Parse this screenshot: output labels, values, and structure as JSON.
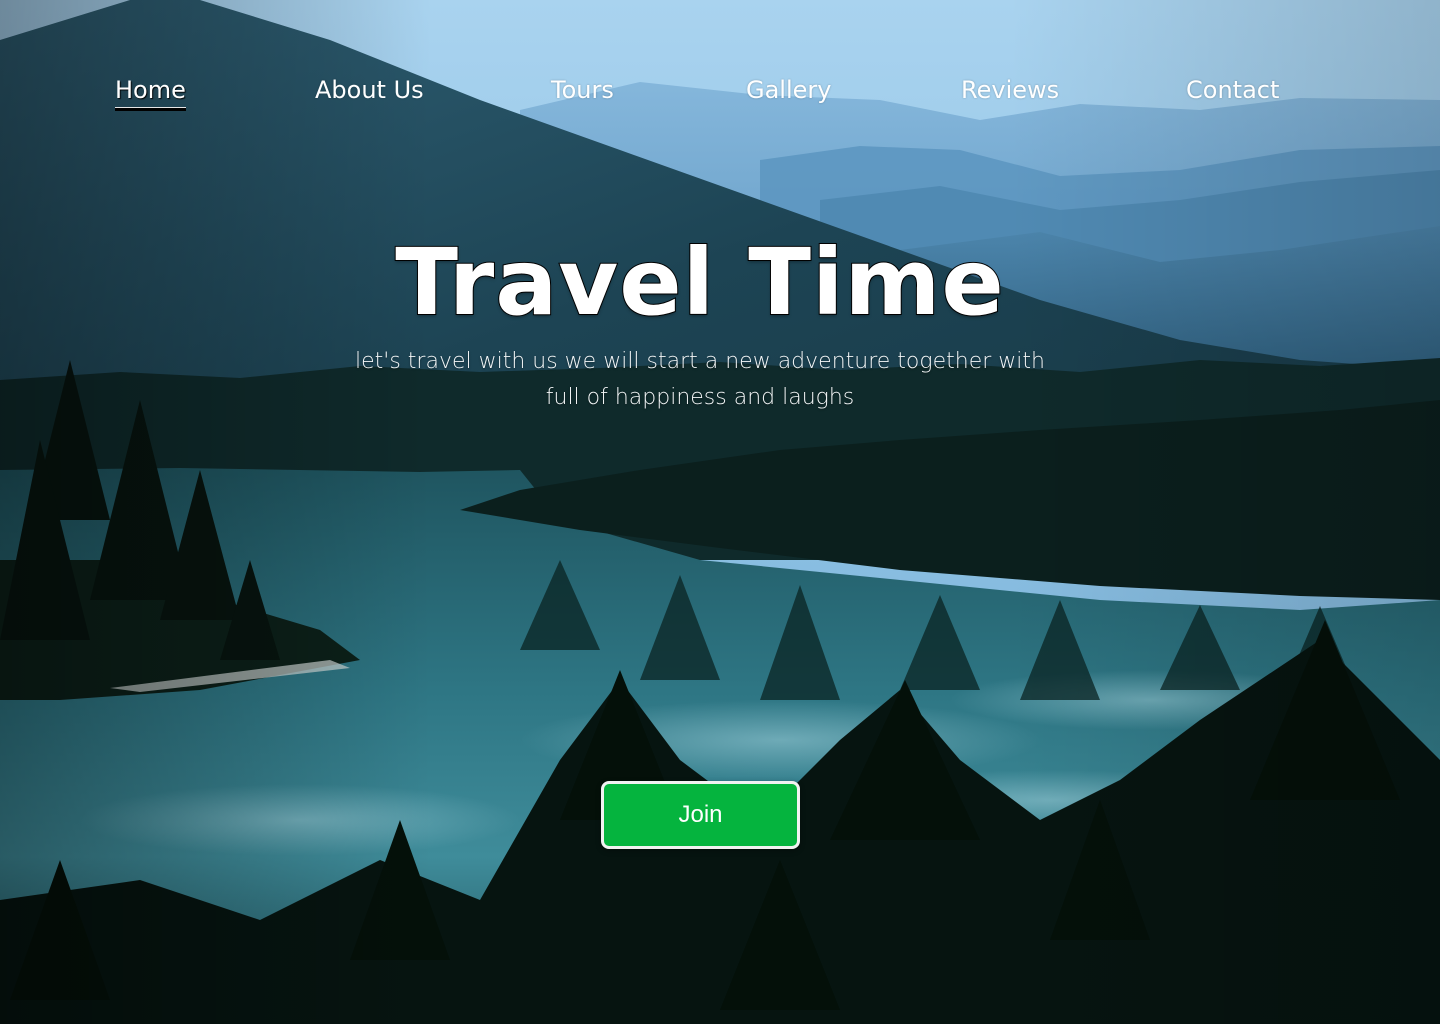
{
  "nav": {
    "items": [
      {
        "label": "Home",
        "active": true
      },
      {
        "label": "About Us",
        "active": false
      },
      {
        "label": "Tours",
        "active": false
      },
      {
        "label": "Gallery",
        "active": false
      },
      {
        "label": "Reviews",
        "active": false
      },
      {
        "label": "Contact",
        "active": false
      }
    ]
  },
  "hero": {
    "title": "Travel Time",
    "subtitle_line1": "let's travel with us we will start a new adventure together with",
    "subtitle_line2": "full of happiness and laughs",
    "cta_label": "Join"
  },
  "colors": {
    "cta_background": "#05b43e",
    "cta_border": "#f2f2f2",
    "text": "#ffffff",
    "sky": "#8cc3e6",
    "water": "#2f6f7d",
    "forest": "#0a1a16"
  }
}
